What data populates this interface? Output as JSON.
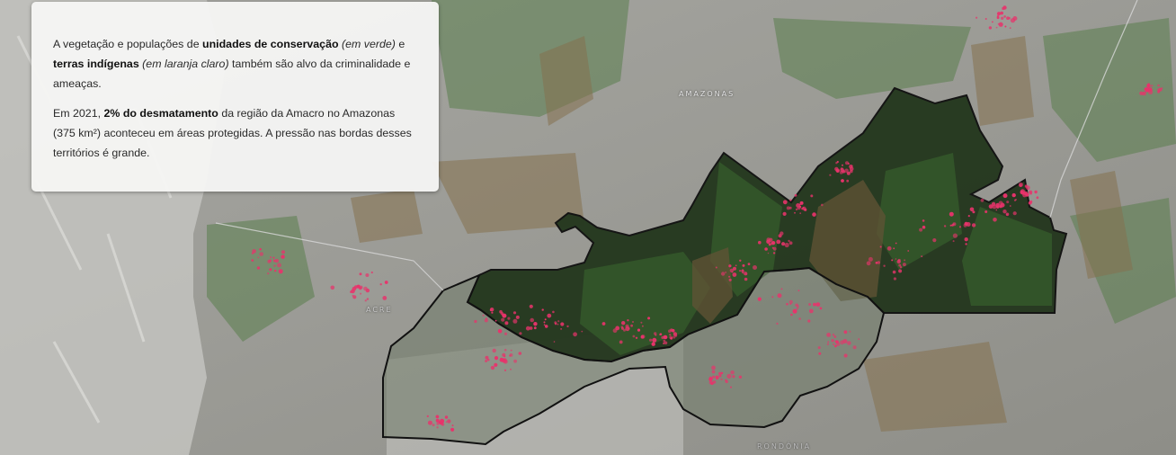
{
  "map": {
    "labels": {
      "state_amazonas": "AMAZONAS",
      "state_acre": "ACRE",
      "state_rondonia": "RONDÔNIA"
    },
    "colors": {
      "protected_area_conservation_unit": "#3d6b34",
      "indigenous_land": "#7a6a48",
      "deforestation": "#e8336b",
      "amacro_region_outline": "#111111"
    }
  },
  "infobox": {
    "p1": {
      "t1": "A vegetação e populações de ",
      "b1": "unidades de conservação",
      "i1": " (em verde)",
      "t2": " e ",
      "b2": "terras indígenas",
      "i2": " (em laranja claro)",
      "t3": " também são alvo da criminalidade e ameaças."
    },
    "p2": {
      "t1": "Em 2021, ",
      "b1": "2% do desmatamento",
      "t2": " da região da Amacro no Amazonas (375 km²) aconteceu em áreas protegidas. A pressão nas bordas desses territórios é grande."
    }
  }
}
